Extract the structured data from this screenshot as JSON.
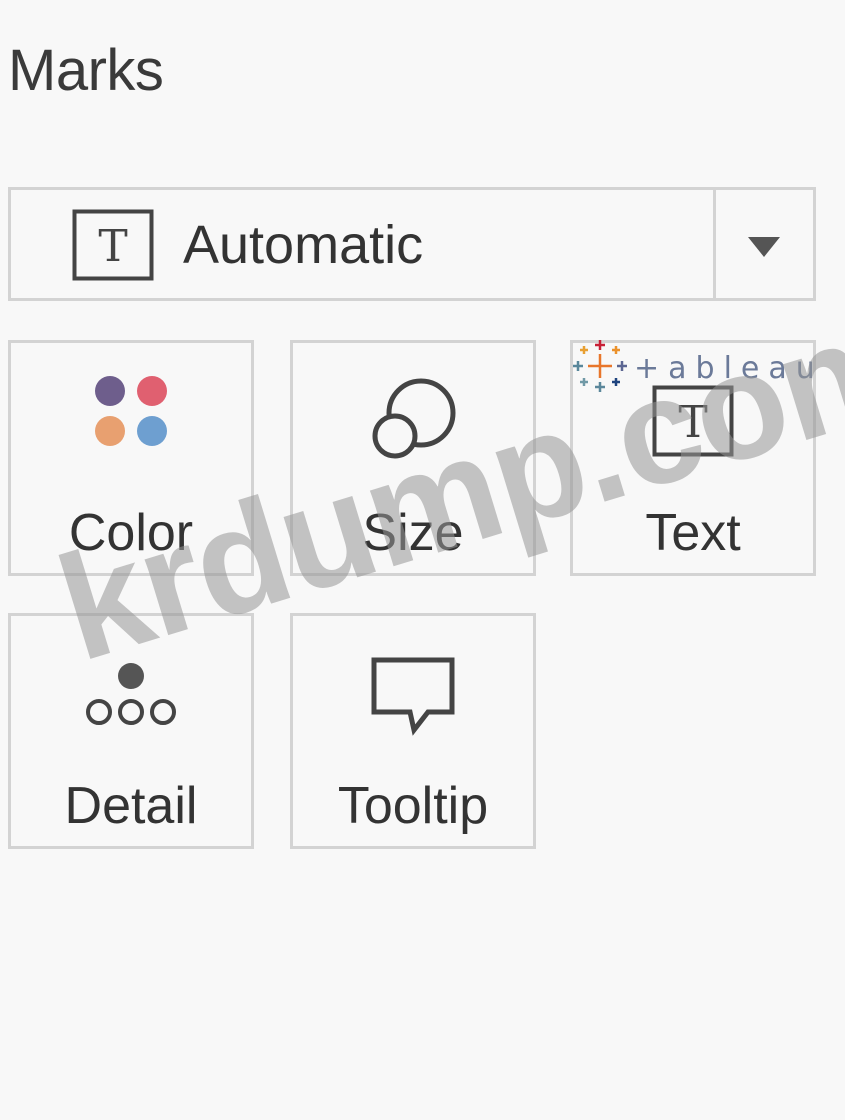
{
  "panel": {
    "title": "Marks"
  },
  "mark_type": {
    "selected": "Automatic",
    "icon": "text-t-icon",
    "arrow_icon": "triangle-down-icon"
  },
  "cards": [
    {
      "label": "Color",
      "icon": "four-color-dots-icon"
    },
    {
      "label": "Size",
      "icon": "overlapping-circles-icon"
    },
    {
      "label": "Text",
      "icon": "text-t-icon"
    },
    {
      "label": "Detail",
      "icon": "detail-dots-icon"
    },
    {
      "label": "Tooltip",
      "icon": "speech-bubble-icon"
    }
  ],
  "overlay": {
    "logo_text": "+ableau",
    "watermark_text": "krdump.com"
  },
  "colors": {
    "background": "#f8f8f8",
    "border": "#d3d3d3",
    "text": "#333333",
    "dot_purple": "#6e5e8c",
    "dot_pink": "#e06070",
    "dot_orange": "#e8a070",
    "dot_blue": "#6e9fd0"
  }
}
